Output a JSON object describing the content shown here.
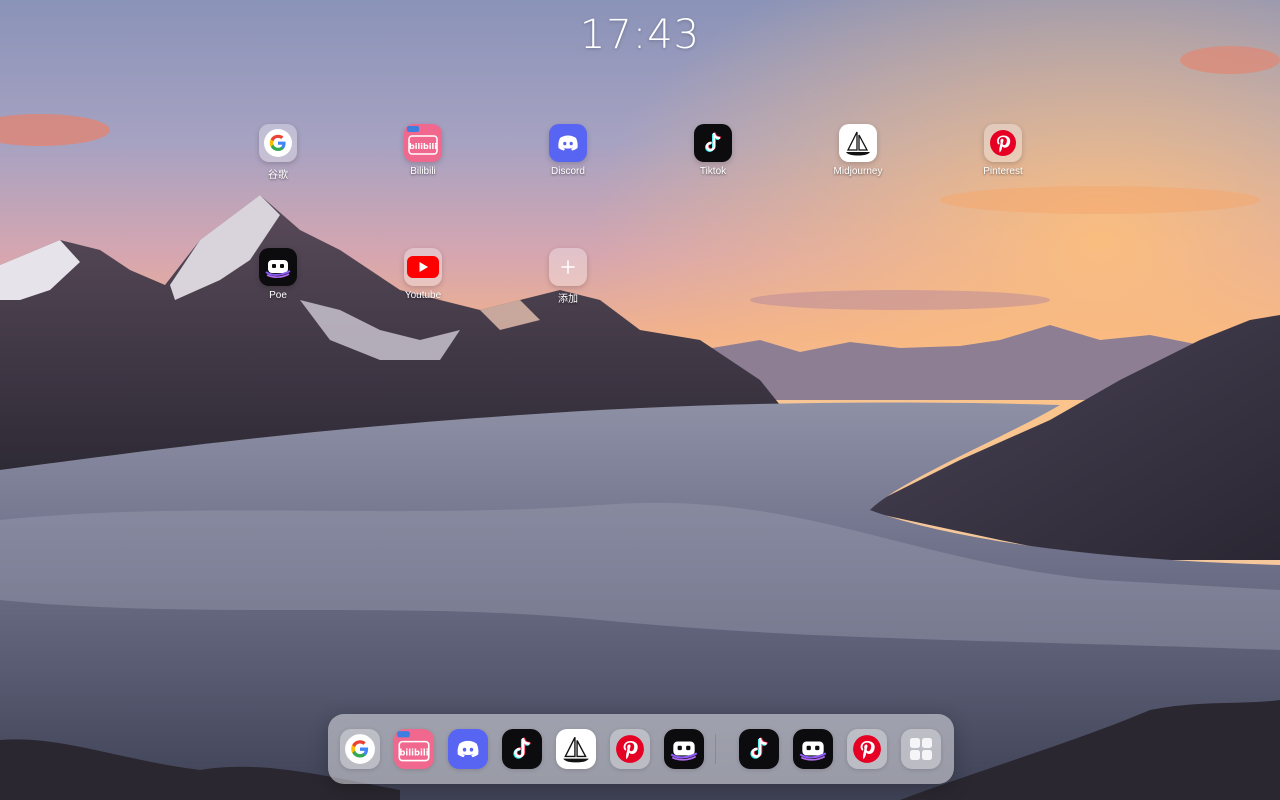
{
  "clock": {
    "time": "17:43"
  },
  "apps": [
    {
      "label": "谷歌",
      "icon": "google-icon"
    },
    {
      "label": "Bilibili",
      "icon": "bilibili-icon"
    },
    {
      "label": "Discord",
      "icon": "discord-icon"
    },
    {
      "label": "Tiktok",
      "icon": "tiktok-icon"
    },
    {
      "label": "Midjourney",
      "icon": "midjourney-icon"
    },
    {
      "label": "Pinterest",
      "icon": "pinterest-icon"
    },
    {
      "label": "Poe",
      "icon": "poe-icon"
    },
    {
      "label": "Youtube",
      "icon": "youtube-icon"
    },
    {
      "label": "添加",
      "icon": "plus-icon"
    }
  ],
  "bilibili_badge": "bilibili",
  "dock": {
    "pinned": [
      "google-icon",
      "bilibili-icon",
      "discord-icon",
      "tiktok-icon",
      "midjourney-icon",
      "pinterest-icon",
      "poe-icon"
    ],
    "recent": [
      "tiktok-icon",
      "poe-icon",
      "pinterest-icon"
    ],
    "all_apps": "app-grid-icon"
  },
  "colors": {
    "discord": "#5865f2",
    "pinterest": "#e60023",
    "youtube": "#ff0000",
    "bilibili": "#f0688e"
  }
}
